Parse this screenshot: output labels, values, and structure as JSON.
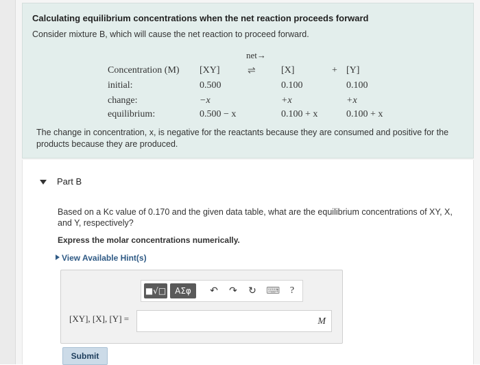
{
  "intro": {
    "title": "Calculating equilibrium concentrations when the net reaction proceeds forward",
    "subtitle": "Consider mixture B, which will cause the net reaction to proceed forward.",
    "table": {
      "net_label": "net→",
      "eq_arrow": "⇌",
      "plus": "+",
      "header_label": "Concentration (M)",
      "species": [
        "[XY]",
        "[X]",
        "[Y]"
      ],
      "rows": [
        {
          "label": "initial:",
          "values": [
            "0.500",
            "0.100",
            "0.100"
          ]
        },
        {
          "label": "change:",
          "values": [
            "−x",
            "+x",
            "+x"
          ]
        },
        {
          "label": "equilibrium:",
          "values": [
            "0.500 − x",
            "0.100 + x",
            "0.100 + x"
          ]
        }
      ]
    },
    "explanation": "The change in concentration, x, is negative for the reactants because they are consumed and positive for the products because they are produced."
  },
  "partB": {
    "label": "Part B",
    "question": "Based on a Kc value of 0.170 and the given data table, what are the equilibrium concentrations of XY, X, and Y, respectively?",
    "instruction": "Express the molar concentrations numerically.",
    "hint_link": "View Available Hint(s)",
    "toolbar": {
      "templates": "■√□",
      "greek": "ΑΣφ",
      "undo": "↶",
      "redo": "↷",
      "reset": "↻",
      "keyboard": "⌨",
      "help": "?"
    },
    "answer_label": "[XY], [X], [Y] =",
    "answer_value": "",
    "unit": "M",
    "submit_label": "Submit"
  }
}
